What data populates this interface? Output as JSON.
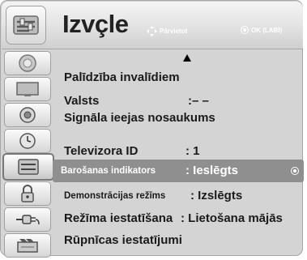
{
  "header": {
    "title": "Izvçle",
    "icon": "options-menu-icon",
    "hint_move_icon": "navigation-arrows-icon",
    "hint_move_label": "Pārvietot",
    "hint_ok_icon": "ok-button-icon",
    "hint_ok_label": "OK (LABI)"
  },
  "sidebar": {
    "items": [
      {
        "icon": "satellite-dish-icon"
      },
      {
        "icon": "tv-screen-icon"
      },
      {
        "icon": "speaker-icon"
      },
      {
        "icon": "clock-icon"
      },
      {
        "icon": "options-icon",
        "active": true
      },
      {
        "icon": "padlock-icon"
      },
      {
        "icon": "plug-cable-icon"
      },
      {
        "icon": "media-film-icon"
      }
    ]
  },
  "menu": {
    "scroll_up_icon": "triangle-up-icon",
    "rows": [
      {
        "label": "Palīdzība invalīdiem",
        "value": ""
      },
      {
        "label": "Valsts",
        "value": ":– –"
      },
      {
        "label": "Signāla ieejas nosaukums",
        "value": ""
      },
      {
        "label": "Televizora ID",
        "value": ": 1"
      },
      {
        "label": "Barošanas indikators",
        "value": ": Ieslēgts",
        "selected": true
      },
      {
        "label": "Demonstrācijas režīms",
        "value": ": Izslēgts"
      },
      {
        "label": "Režīma iestatīšana",
        "value": ": Lietošana mājās"
      },
      {
        "label": "Rūpnīcas iestatījumi",
        "value": ""
      }
    ]
  }
}
